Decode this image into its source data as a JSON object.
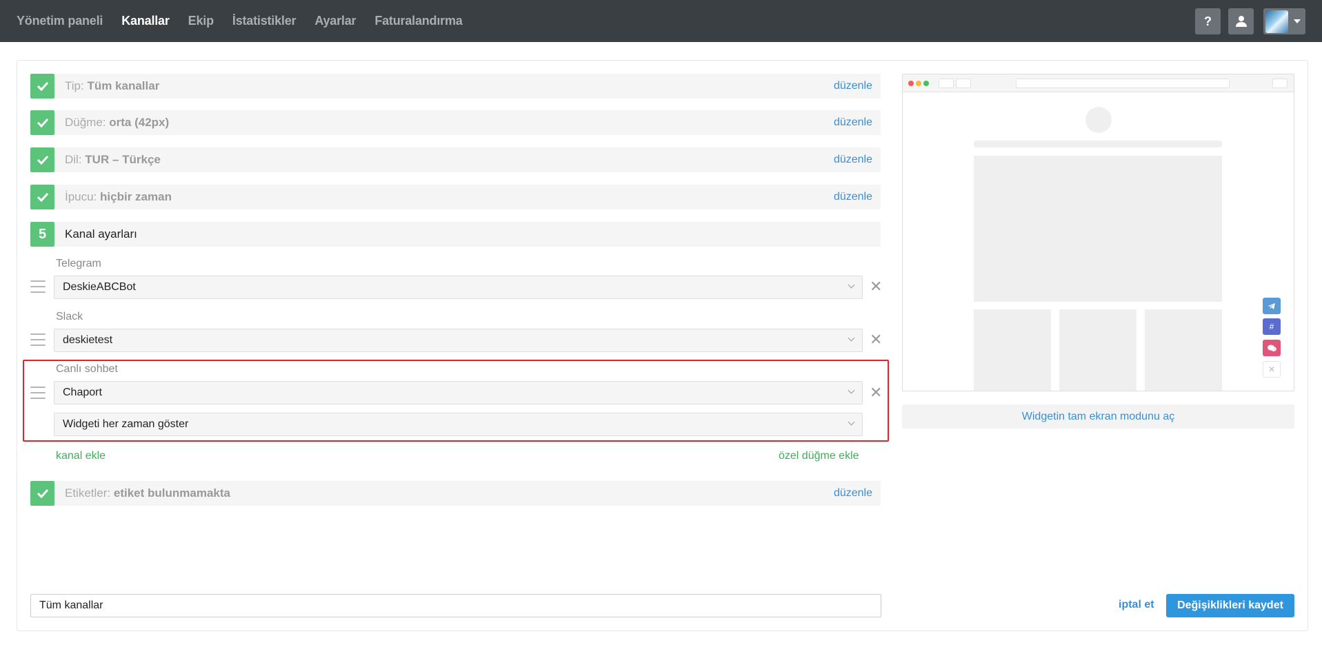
{
  "nav": {
    "items": [
      "Yönetim paneli",
      "Kanallar",
      "Ekip",
      "İstatistikler",
      "Ayarlar",
      "Faturalandırma"
    ],
    "active": "Kanallar",
    "help_label": "?"
  },
  "steps": {
    "type": {
      "label": "Tip:",
      "value": "Tüm kanallar",
      "edit": "düzenle"
    },
    "button": {
      "label": "Düğme:",
      "value": "orta (42px)",
      "edit": "düzenle"
    },
    "language": {
      "label": "Dil:",
      "value": "TUR – Türkçe",
      "edit": "düzenle"
    },
    "tooltip": {
      "label": "İpucu:",
      "value": "hiçbir zaman",
      "edit": "düzenle"
    },
    "channel_settings": {
      "number": "5",
      "title": "Kanal ayarları"
    },
    "tags": {
      "label": "Etiketler:",
      "value": "etiket bulunmamakta",
      "edit": "düzenle"
    }
  },
  "channels": {
    "telegram": {
      "label": "Telegram",
      "value": "DeskieABCBot"
    },
    "slack": {
      "label": "Slack",
      "value": "deskietest"
    },
    "livechat": {
      "label": "Canlı sohbet",
      "value": "Chaport",
      "mode": "Widgeti her zaman göster"
    },
    "add_channel": "kanal ekle",
    "add_custom_button": "özel düğme ekle"
  },
  "preview": {
    "fullscreen_link": "Widgetin tam ekran modunu aç",
    "dot_colors": [
      "#f45b5b",
      "#f5bd3c",
      "#3fc45a"
    ],
    "icons": [
      {
        "name": "telegram-icon",
        "color": "#5b9bd5"
      },
      {
        "name": "slack-icon",
        "color": "#5b6ccf"
      },
      {
        "name": "chat-icon",
        "color": "#e0557a"
      },
      {
        "name": "close-icon",
        "color": "#ffffff"
      }
    ]
  },
  "footer": {
    "name_value": "Tüm kanallar",
    "cancel": "iptal et",
    "save": "Değişiklikleri kaydet"
  }
}
